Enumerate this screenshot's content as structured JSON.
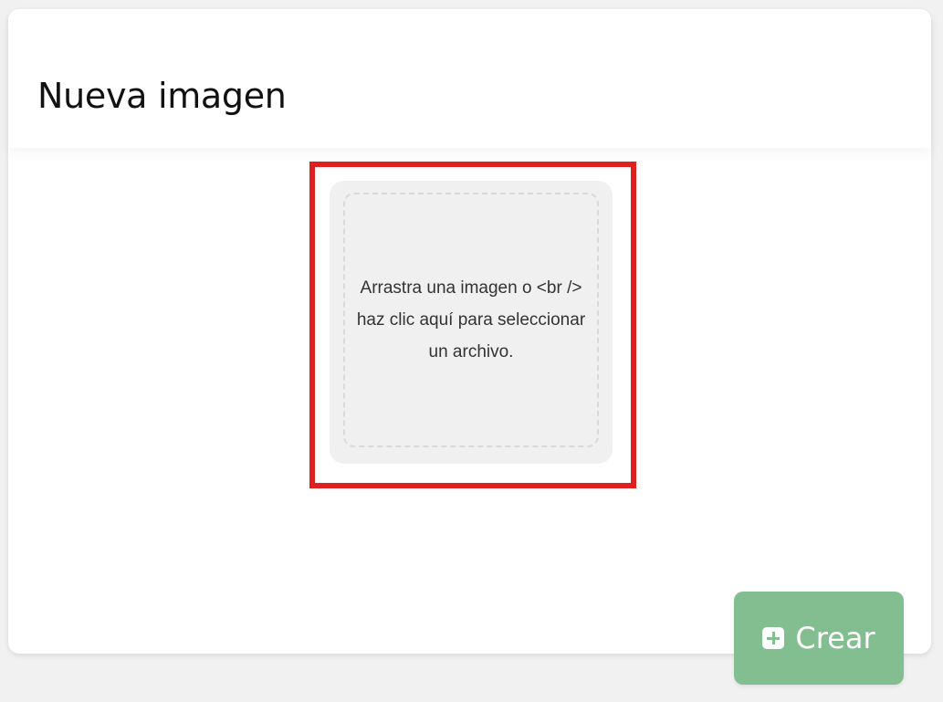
{
  "dialog": {
    "title": "Nueva imagen"
  },
  "upload": {
    "instructions": "Arrastra una imagen o <br /> haz clic aquí para seleccionar un archivo."
  },
  "actions": {
    "create_label": "Crear",
    "create_icon": "plus-square-icon"
  },
  "colors": {
    "highlight": "#e0201f",
    "dropzone": "#f0f0f0",
    "create_button": "#83be90"
  }
}
